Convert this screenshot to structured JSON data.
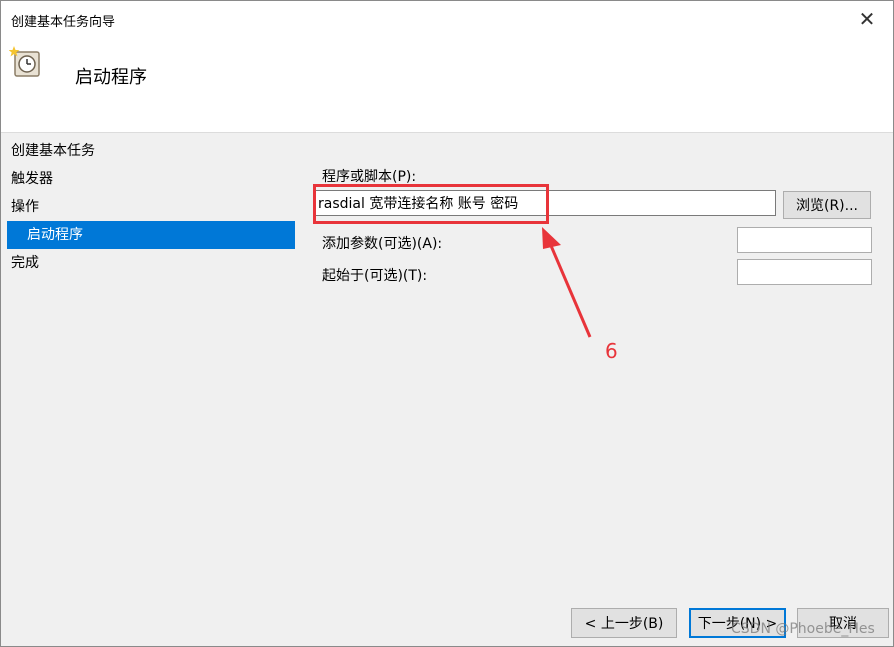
{
  "window": {
    "title": "创建基本任务向导",
    "close_glyph": "✕"
  },
  "header": {
    "title": "启动程序",
    "icon": "task-clock-icon"
  },
  "sidebar": {
    "items": [
      {
        "label": "创建基本任务",
        "active": false
      },
      {
        "label": "触发器",
        "active": false
      },
      {
        "label": "操作",
        "active": false
      },
      {
        "label": "启动程序",
        "active": true
      },
      {
        "label": "完成",
        "active": false
      }
    ]
  },
  "form": {
    "program_label": "程序或脚本(P):",
    "program_value": "rasdial 宽带连接名称 账号 密码",
    "browse_label": "浏览(R)...",
    "args_label": "添加参数(可选)(A):",
    "args_value": "",
    "start_label": "起始于(可选)(T):",
    "start_value": ""
  },
  "buttons": {
    "back_label": "< 上一步(B)",
    "next_label": "下一步(N) >",
    "cancel_label": "取消"
  },
  "annotation": {
    "number": "6",
    "color": "#e8343a"
  },
  "watermark": "CSDN @Phoebe_Hes",
  "colors": {
    "accent": "#0078d7",
    "annotation": "#e8343a"
  }
}
